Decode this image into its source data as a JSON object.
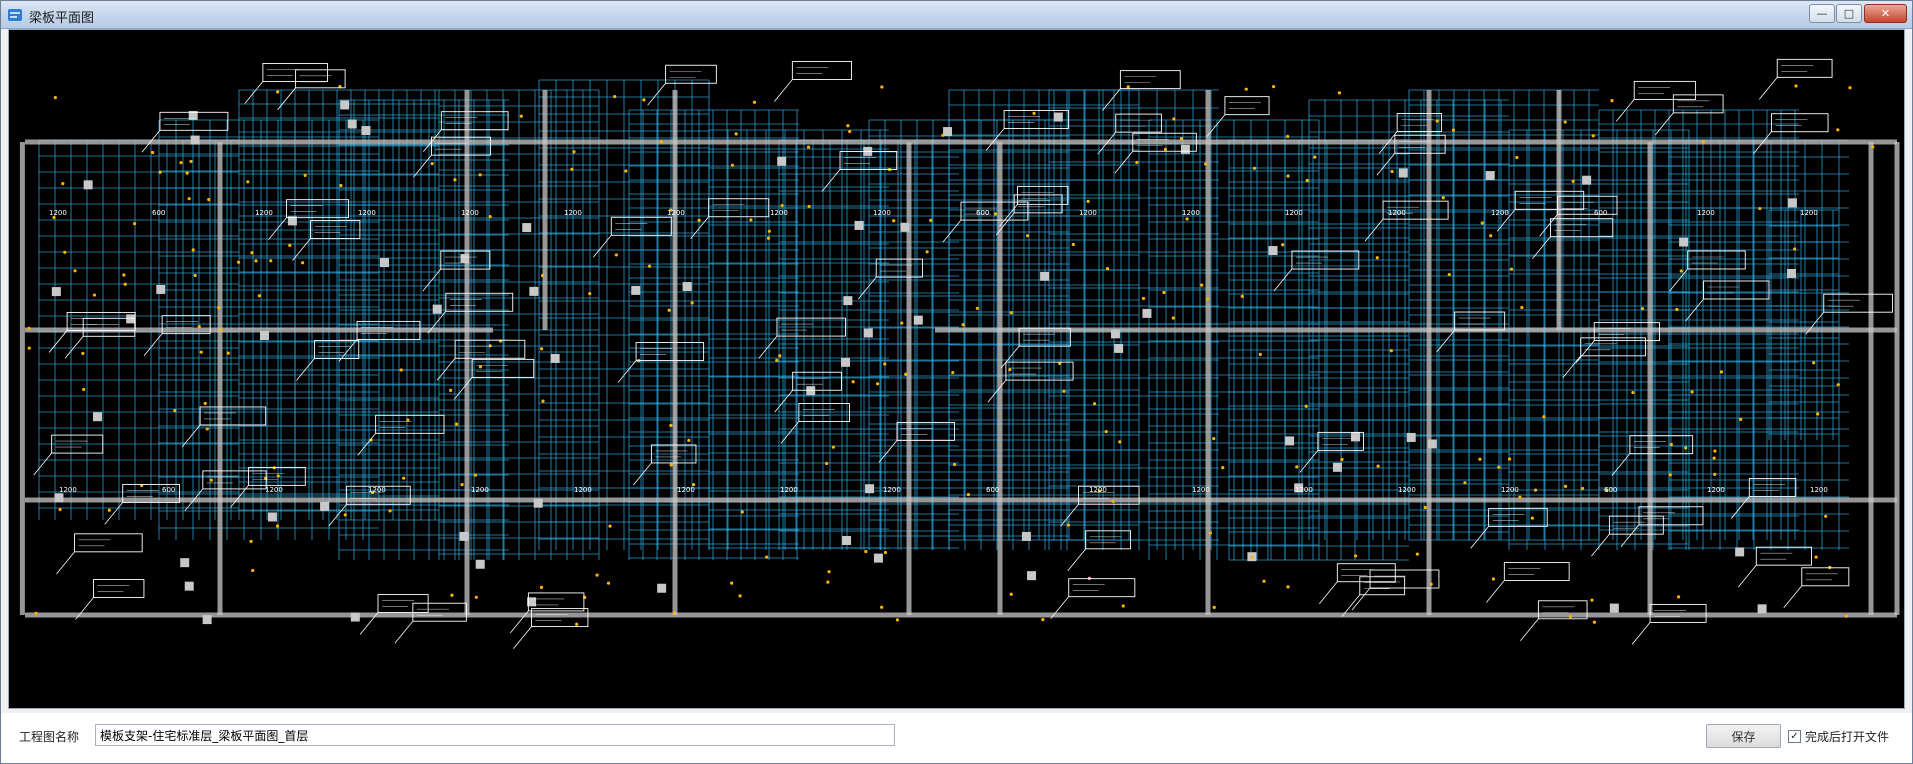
{
  "window": {
    "title": "梁板平面图",
    "controls": {
      "minimize": "—",
      "maximize": "□",
      "close": "✕"
    }
  },
  "footer": {
    "project_label": "工程图名称",
    "project_value": "模板支架-住宅标准层_梁板平面图_首层",
    "save_label": "保存",
    "open_after_label": "完成后打开文件",
    "open_after_checked": "✓"
  },
  "drawing": {
    "dimension_labels": [
      "1200",
      "600",
      "1200",
      "1200",
      "1200",
      "1200",
      "1200",
      "1200",
      "1200",
      "600",
      "1200",
      "1200",
      "1200",
      "1200",
      "1200",
      "600",
      "1200",
      "1200"
    ],
    "colors": {
      "background": "#000000",
      "support_grid": "#32b6f0",
      "walls": "#c8c8c8",
      "tag": "#ffffff",
      "node": "#ffb400"
    }
  }
}
